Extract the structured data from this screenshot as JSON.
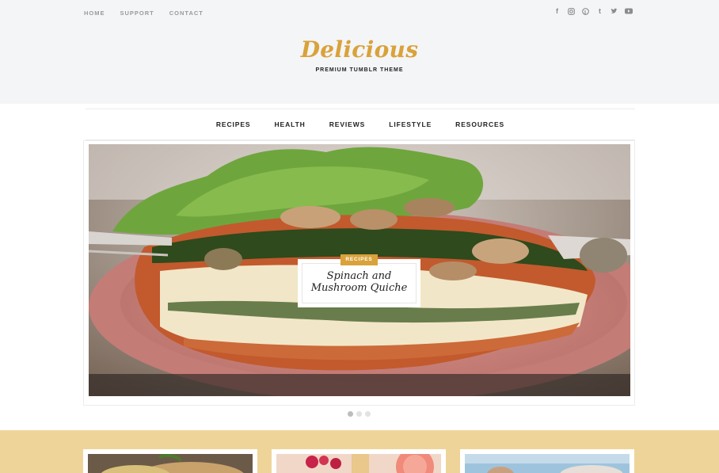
{
  "header": {
    "top_links": [
      "HOME",
      "SUPPORT",
      "CONTACT"
    ],
    "social_icons": [
      "facebook-icon",
      "instagram-icon",
      "pinterest-icon",
      "tumblr-icon",
      "twitter-icon",
      "youtube-icon"
    ],
    "logo": "Delicious",
    "tagline": "PREMIUM TUMBLR THEME"
  },
  "nav": {
    "items": [
      "RECIPES",
      "HEALTH",
      "REVIEWS",
      "LIFESTYLE",
      "RESOURCES"
    ]
  },
  "slider": {
    "category": "RECIPES",
    "title_line1": "Spinach and",
    "title_line2": "Mushroom Quiche",
    "dots": 3,
    "active_dot": 1
  },
  "colors": {
    "accent": "#d9a23a",
    "header_bg": "#f4f5f7",
    "featured_bg": "#efd49a"
  }
}
